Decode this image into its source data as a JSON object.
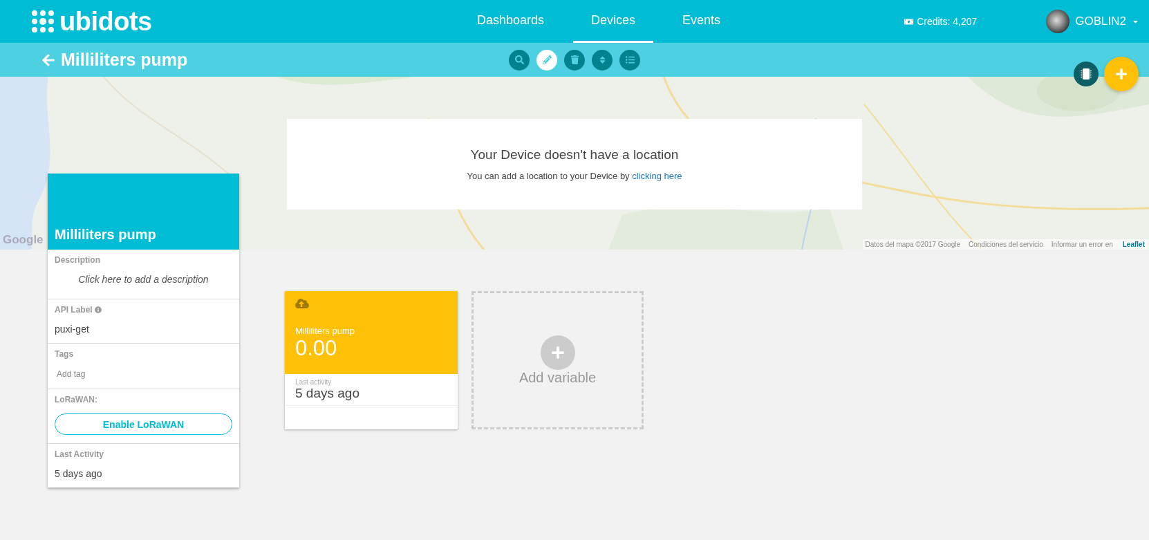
{
  "header": {
    "logo": "ubidots",
    "nav": [
      {
        "label": "Dashboards",
        "selected": false
      },
      {
        "label": "Devices",
        "selected": true
      },
      {
        "label": "Events",
        "selected": false
      }
    ],
    "credits": "Credits: 4,207",
    "user": "GOBLIN2"
  },
  "subheader": {
    "back_title": "Milliliters pump",
    "tools": [
      {
        "kind": "search",
        "selected": false
      },
      {
        "kind": "edit",
        "selected": true
      },
      {
        "kind": "delete",
        "selected": false
      },
      {
        "kind": "sort",
        "selected": false
      },
      {
        "kind": "list",
        "selected": false
      }
    ]
  },
  "map": {
    "google_logo": "Google",
    "message_title": "Your Device doesn't have a location",
    "message_text": "You can add a location to your Device by ",
    "message_link": "clicking here",
    "attribution": [
      "Datos del mapa ©2017 Google",
      "Condiciones del servicio",
      "Informar un error en"
    ],
    "leaflet": "Leaflet"
  },
  "device_card": {
    "title": "Milliliters pump",
    "sections": [
      {
        "kind": "description",
        "label": "Description",
        "value": "Click here to add a description"
      },
      {
        "kind": "api",
        "label": "API Label",
        "value": "puxi-get"
      },
      {
        "kind": "tags",
        "label": "Tags",
        "placeholder": "Add tag"
      },
      {
        "kind": "button",
        "label": "LoRaWAN:",
        "button": "Enable LoRaWAN"
      },
      {
        "kind": "text",
        "label": "Last Activity",
        "value": "5 days ago"
      }
    ]
  },
  "variables": [
    {
      "name": "Milliliters pump",
      "value": "0.00",
      "activity_label": "Last activity",
      "activity": "5 days ago",
      "color": "#ffc107"
    }
  ],
  "add_variable": "Add variable"
}
